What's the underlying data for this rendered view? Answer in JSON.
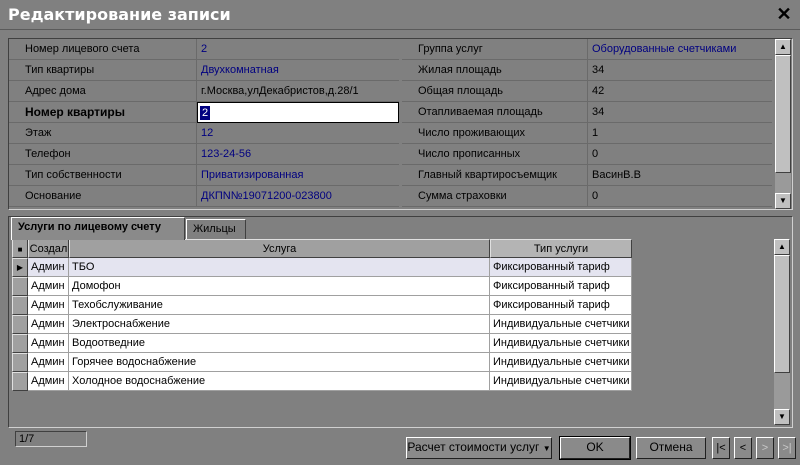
{
  "window": {
    "title": "Редактирование записи"
  },
  "left_props": [
    {
      "label": "Номер лицевого счета",
      "value": "2",
      "active": false
    },
    {
      "label": "Тип квартиры",
      "value": "Двухкомнатная",
      "active": false
    },
    {
      "label": "Адрес дома",
      "value": "г.Москва,улДекабристов,д.28/1",
      "active": false
    },
    {
      "label": "Номер квартиры",
      "value": "2",
      "active": true
    },
    {
      "label": "Этаж",
      "value": "12",
      "active": false
    },
    {
      "label": "Телефон",
      "value": "123-24-56",
      "active": false
    },
    {
      "label": "Тип собственности",
      "value": "Приватизированная",
      "active": false
    },
    {
      "label": "Основание",
      "value": "ДКПN№19071200-023800",
      "active": false
    }
  ],
  "right_props": [
    {
      "label": "Группа услуг",
      "value": "Оборудованные счетчиками"
    },
    {
      "label": "Жилая площадь",
      "value": "34"
    },
    {
      "label": "Общая площадь",
      "value": "42"
    },
    {
      "label": "Отапливаемая площадь",
      "value": "34"
    },
    {
      "label": "Число проживающих",
      "value": "1"
    },
    {
      "label": "Число прописанных",
      "value": "0"
    },
    {
      "label": "Главный квартиросъемщик",
      "value": "ВасинВ.В"
    },
    {
      "label": "Сумма страховки",
      "value": "0"
    }
  ],
  "tabs": [
    {
      "label": "Услуги по лицевому счету",
      "active": true
    },
    {
      "label": "Жильцы",
      "active": false
    }
  ],
  "services_table": {
    "columns": [
      "Создал",
      "Услуга",
      "Тип услуги"
    ],
    "rows": [
      [
        "Админ",
        "ТБО",
        "Фиксированный тариф"
      ],
      [
        "Админ",
        "Домофон",
        "Фиксированный тариф"
      ],
      [
        "Админ",
        "Техобслуживание",
        "Фиксированный тариф"
      ],
      [
        "Админ",
        "Электроснабжение",
        "Индивидуальные счетчики"
      ],
      [
        "Админ",
        "Водоотведние",
        "Индивидуальные счетчики"
      ],
      [
        "Админ",
        "Горячее водоснабжение",
        "Индивидуальные счетчики"
      ],
      [
        "Админ",
        "Холодное водоснабжение",
        "Индивидуальные счетчики"
      ]
    ],
    "record_counter": "1/7"
  },
  "buttons": {
    "calc": "Расчет стоимости услуг",
    "ok": "OK",
    "cancel": "Отмена"
  },
  "icons": {
    "close": "close-icon",
    "row_pointer": "triangle-right-icon",
    "nav_first": "first-record-icon",
    "nav_prev": "prev-record-icon",
    "nav_next": "next-record-icon",
    "nav_last": "last-record-icon"
  },
  "colors": {
    "value_text": "#000080",
    "background": "#808080"
  }
}
